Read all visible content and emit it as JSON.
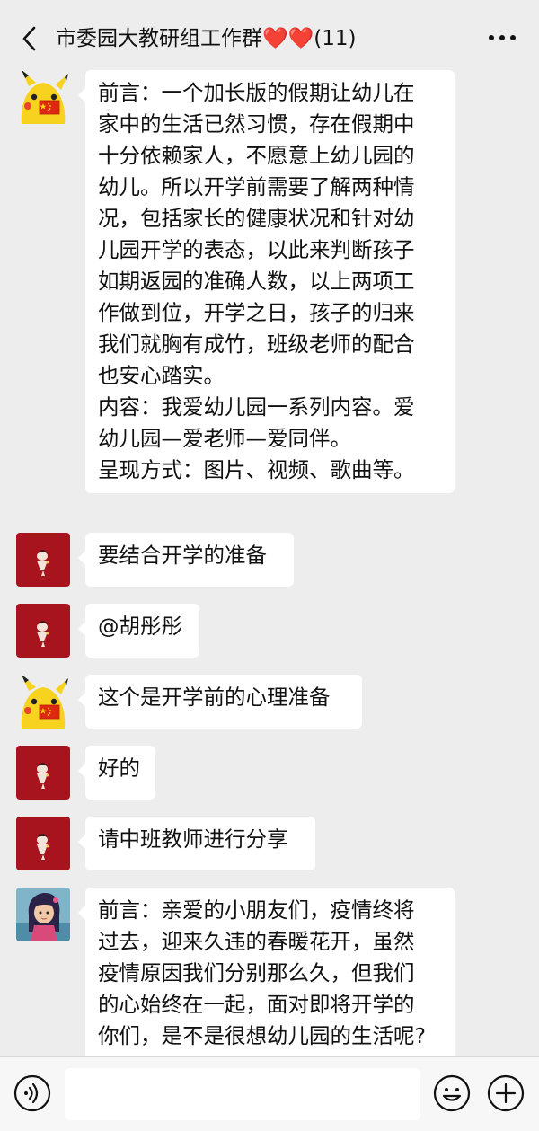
{
  "header": {
    "title": "市委园大教研组工作群❤️❤️(11)",
    "back_icon": "chevron-left-icon",
    "more_icon": "more-dots-icon"
  },
  "messages": [
    {
      "avatar": "pikachu-flag-avatar",
      "lines": [
        "前言：一个加长版的假期让幼儿在",
        "家中的生活已然习惯，存在假期中",
        "十分依赖家人，不愿意上幼儿园的",
        "幼儿。所以开学前需要了解两种情",
        "况，包括家长的健康状况和针对幼",
        "儿园开学的表态，以此来判断孩子",
        "如期返园的准确人数，以上两项工",
        "作做到位，开学之日，孩子的归来",
        "我们就胸有成竹，班级老师的配合",
        "也安心踏实。",
        "内容：我爱幼儿园一系列内容。爱",
        "幼儿园—爱老师—爱同伴。",
        "呈现方式：图片、视频、歌曲等。"
      ]
    },
    {
      "avatar": "red-illustration-avatar",
      "lines": [
        "要结合开学的准备"
      ]
    },
    {
      "avatar": "red-illustration-avatar",
      "lines": [
        "@胡彤彤"
      ]
    },
    {
      "avatar": "pikachu-flag-avatar",
      "lines": [
        "这个是开学前的心理准备"
      ]
    },
    {
      "avatar": "red-illustration-avatar",
      "lines": [
        "好的"
      ]
    },
    {
      "avatar": "red-illustration-avatar",
      "lines": [
        "请中班教师进行分享"
      ]
    },
    {
      "avatar": "cartoon-girl-avatar",
      "lines": [
        "前言：亲爱的小朋友们，疫情终将",
        "过去，迎来久违的春暖花开，虽然",
        "疫情原因我们分别那么久，但我们",
        "的心始终在一起，面对即将开学的",
        "你们，是不是很想幼儿园的生活呢?"
      ]
    }
  ],
  "input_bar": {
    "voice_icon": "voice-icon",
    "input_value": "",
    "emoji_icon": "emoji-icon",
    "plus_icon": "plus-icon"
  },
  "colors": {
    "background": "#ededed",
    "bubble": "#ffffff",
    "red_avatar": "#a8141d",
    "pikachu_yellow": "#f7d21e",
    "flag_red": "#de2910"
  }
}
